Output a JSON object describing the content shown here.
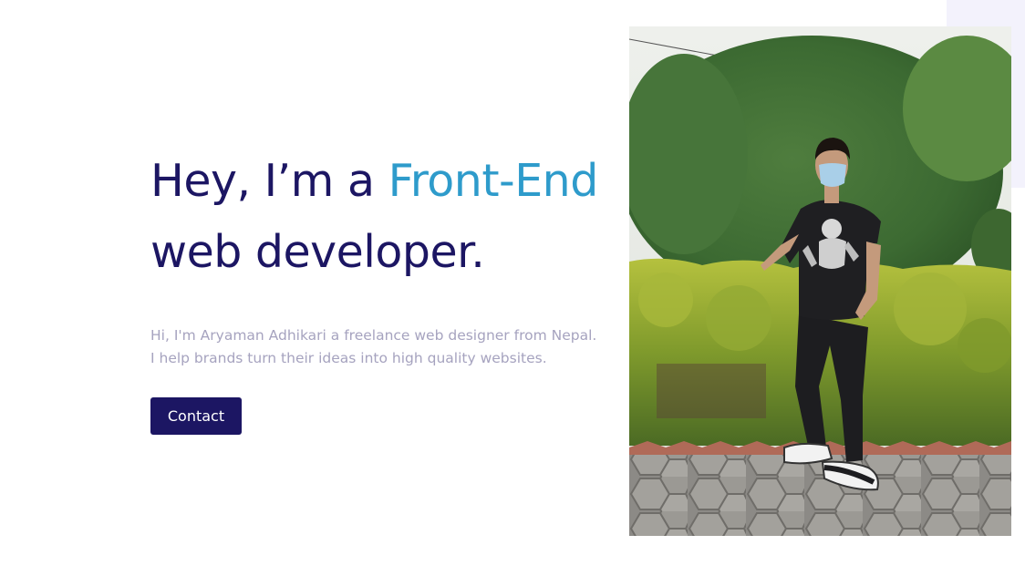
{
  "hero": {
    "headline_prefix": "Hey, I’m a ",
    "headline_accent": "Front-End",
    "headline_line2": "web developer.",
    "intro_line1": "Hi, I'm Aryaman Adhikari a freelance web designer from Nepal.",
    "intro_line2": "I help brands turn their ideas into high quality websites.",
    "contact_label": "Contact"
  },
  "colors": {
    "heading": "#1c1663",
    "accent": "#2e9bcb",
    "body_text": "#a6a3bf",
    "button_bg": "#1c1663",
    "corner_accent": "#f3f2fc"
  },
  "photo": {
    "description_icon": "portrait-photo"
  }
}
